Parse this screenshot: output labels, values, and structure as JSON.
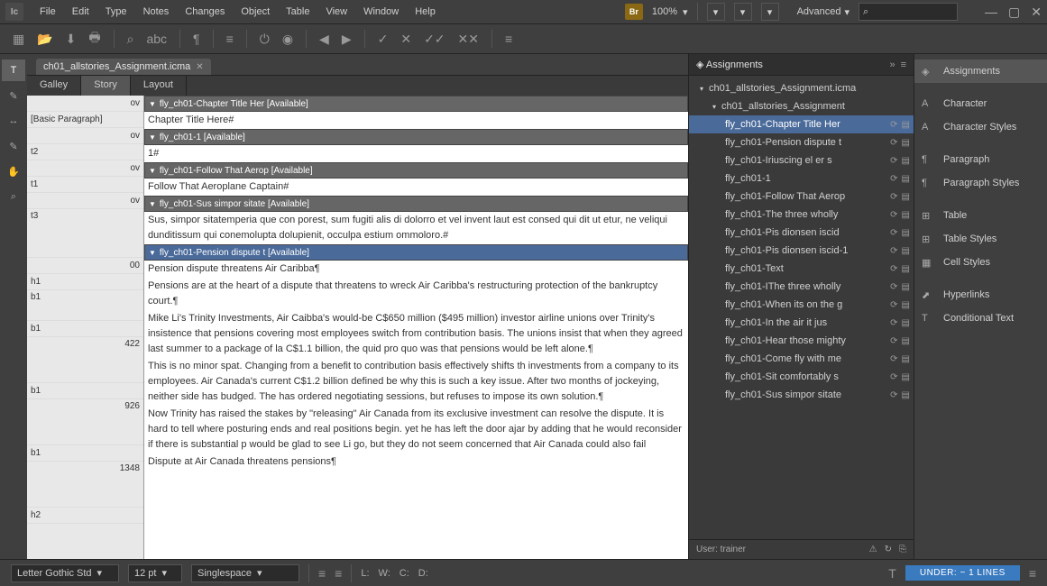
{
  "app_icon": "Ic",
  "menu": [
    "File",
    "Edit",
    "Type",
    "Notes",
    "Changes",
    "Object",
    "Table",
    "View",
    "Window",
    "Help"
  ],
  "zoom": "100%",
  "workspace": "Advanced",
  "doc_tab": "ch01_allstories_Assignment.icma",
  "view_tabs": [
    "Galley",
    "Story",
    "Layout"
  ],
  "stories": [
    {
      "header": "fly_ch01-Chapter Title Her [Available]",
      "gutter_left": "",
      "gutter_right": "ov",
      "text": "Chapter Title Here#",
      "gl2": "[Basic Paragraph]"
    },
    {
      "header": "fly_ch01-1 [Available]",
      "gutter_left": "",
      "gutter_right": "ov",
      "text": "1#",
      "gl2": "t2"
    },
    {
      "header": "fly_ch01-Follow That Aerop [Available]",
      "gutter_left": "",
      "gutter_right": "ov",
      "text": "Follow That Aeroplane Captain#",
      "gl2": "t1"
    },
    {
      "header": "fly_ch01-Sus simpor sitate [Available]",
      "gutter_left": "",
      "gutter_right": "ov",
      "text": "Sus, simpor sitatemperia que con porest, sum fugiti alis di dolorro et vel invent laut est consed qui dit ut etur, ne veliqui dunditissum qui conemolupta dolupienit, occulpa estium ommoloro.#",
      "gl2": "t3"
    },
    {
      "header": "fly_ch01-Pension dispute t [Available]",
      "sel": true,
      "gutter_left": "",
      "gutter_right": "00"
    }
  ],
  "pension_body": {
    "h1": "Pension dispute threatens Air Caribba¶",
    "b1": "Pensions are at the heart of a dispute that threatens to wreck Air Caribba's restructuring protection of the bankruptcy court.¶",
    "b2": "Mike Li's Trinity Investments, Air Caibba's would-be C$650 million ($495 million) investor airline unions over Trinity's insistence that pensions covering most employees switch from contribution basis. The unions insist that when they agreed last summer to a package of la C$1.1 billion, the quid pro quo was that pensions would be left alone.¶",
    "b3": "This is no minor spat. Changing from a benefit to contribution basis effectively shifts th investments from a company to its employees. Air Canada's current C$1.2 billion defined be why this is such a key issue. After two months of jockeying, neither side has budged. The has ordered negotiating sessions, but refuses to impose its own solution.¶",
    "b4": "Now Trinity has raised the stakes by \"releasing\" Air Canada from its exclusive investment can resolve the dispute. It is hard to tell where posturing ends and real positions begin. yet he has left the door ajar by adding that he would reconsider if there is substantial p would be glad to see Li go, but they do not seem concerned that Air Canada could also fail",
    "h2": "Dispute at Air Canada threatens pensions¶"
  },
  "gutter_extra": {
    "g_h1": "h1",
    "g_b1a": "b1",
    "g_b1b": "b1",
    "g_422": "422",
    "g_b1c": "b1",
    "g_926": "926",
    "g_b1d": "b1",
    "g_1348": "1348",
    "g_h2": "h2"
  },
  "assignments": {
    "title": "Assignments",
    "root": "ch01_allstories_Assignment.icma",
    "group": "ch01_allstories_Assignment",
    "items": [
      {
        "label": "fly_ch01-Chapter Title Her",
        "sel": true
      },
      {
        "label": "fly_ch01-Pension dispute t"
      },
      {
        "label": "fly_ch01-Iriuscing el er s"
      },
      {
        "label": "fly_ch01-1"
      },
      {
        "label": "fly_ch01-Follow That Aerop"
      },
      {
        "label": "fly_ch01-The three wholly"
      },
      {
        "label": "fly_ch01-Pis dionsen iscid"
      },
      {
        "label": "fly_ch01-Pis dionsen iscid-1"
      },
      {
        "label": "fly_ch01-Text"
      },
      {
        "label": "fly_ch01-IThe three wholly"
      },
      {
        "label": "fly_ch01-When its on the g"
      },
      {
        "label": "fly_ch01-In the air it jus"
      },
      {
        "label": "fly_ch01-Hear those mighty"
      },
      {
        "label": "fly_ch01-Come fly with me"
      },
      {
        "label": "fly_ch01-Sit comfortably s"
      },
      {
        "label": "fly_ch01-Sus simpor sitate"
      }
    ],
    "user": "User: trainer"
  },
  "right_panels": [
    "Assignments",
    "Character",
    "Character Styles",
    "Paragraph",
    "Paragraph Styles",
    "Table",
    "Table Styles",
    "Cell Styles",
    "Hyperlinks",
    "Conditional Text"
  ],
  "status": {
    "font": "Letter Gothic Std",
    "size": "12 pt",
    "leading": "Singlespace",
    "L": "L:",
    "W": "W:",
    "C": "C:",
    "D": "D:",
    "under": "UNDER: ~ 1 LINES"
  }
}
